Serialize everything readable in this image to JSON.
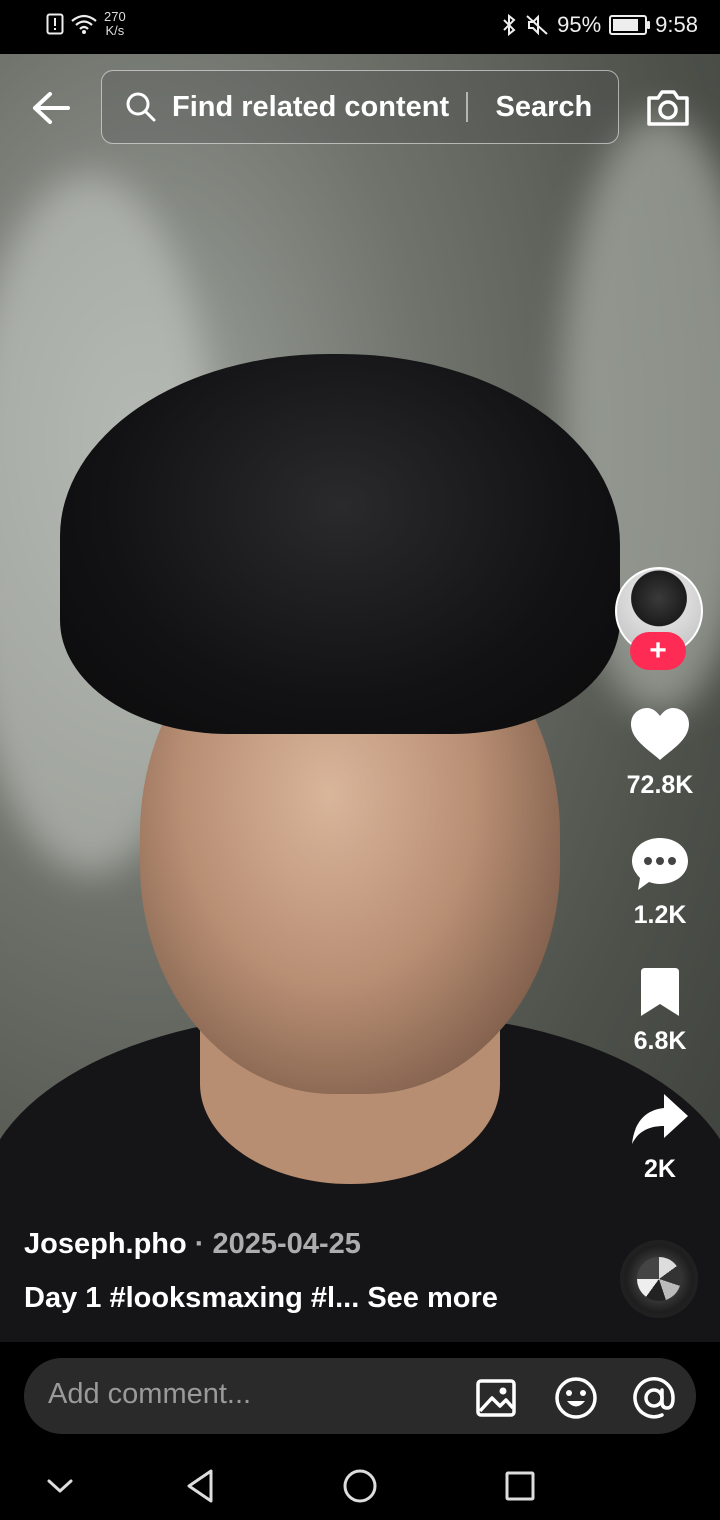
{
  "status_bar": {
    "net_speed_value": "270",
    "net_speed_unit": "K/s",
    "battery": "95%",
    "battery_level": 0.95,
    "time": "9:58"
  },
  "search": {
    "placeholder": "Find related content",
    "button_label": "Search"
  },
  "icons": {
    "back": "back-arrow-icon",
    "search": "search-icon",
    "camera": "camera-icon",
    "like": "heart-icon",
    "comment": "comment-icon",
    "favorite": "bookmark-icon",
    "share": "share-icon",
    "gallery": "image-icon",
    "emoji": "emoji-icon",
    "mention": "at-icon"
  },
  "actions": {
    "likes": "72.8K",
    "comments": "1.2K",
    "favorites": "6.8K",
    "shares": "2K"
  },
  "follow_symbol": "+",
  "post": {
    "author": "Joseph.pho",
    "separator": " · ",
    "date": "2025-04-25",
    "caption": "Day 1 #looksmaxing #l...",
    "see_more": "See more"
  },
  "comment_bar": {
    "placeholder": "Add comment..."
  },
  "colors": {
    "follow_accent": "#fe2c55",
    "background": "#000000"
  }
}
